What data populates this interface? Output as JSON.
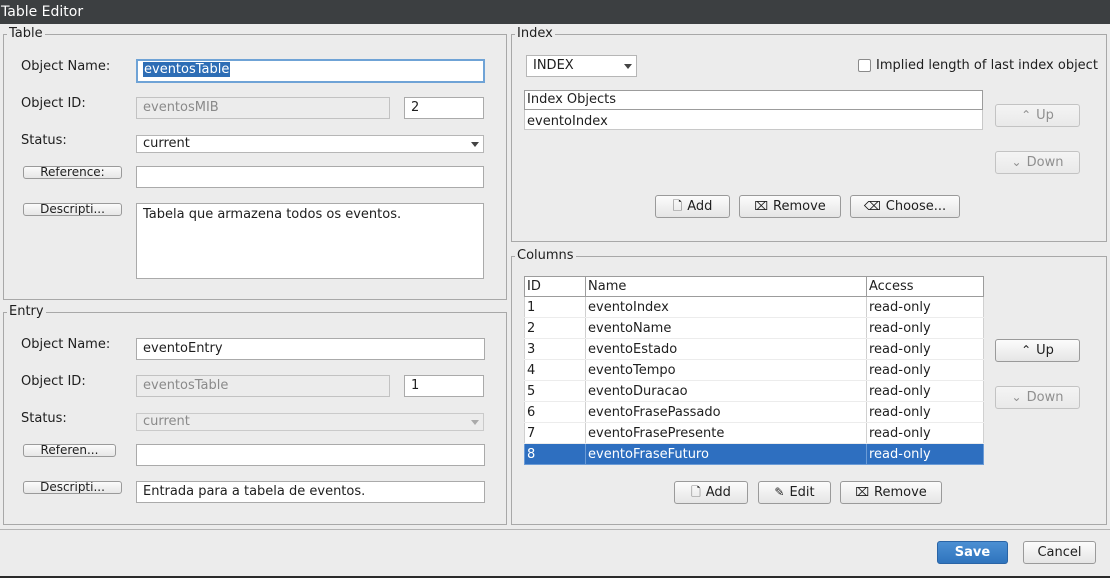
{
  "window": {
    "title": "Table Editor"
  },
  "table_group": {
    "legend": "Table",
    "object_name_label": "Object Name:",
    "object_name_value": "eventosTable",
    "object_id_label": "Object ID:",
    "object_id_parent": "eventosMIB",
    "object_id_number": "2",
    "status_label": "Status:",
    "status_value": "current",
    "reference_button": "Reference:",
    "reference_value": "",
    "description_button": "Descripti...",
    "description_value": "Tabela que armazena todos os eventos."
  },
  "entry_group": {
    "legend": "Entry",
    "object_name_label": "Object Name:",
    "object_name_value": "eventoEntry",
    "object_id_label": "Object ID:",
    "object_id_parent": "eventosTable",
    "object_id_number": "1",
    "status_label": "Status:",
    "status_value": "current",
    "reference_button": "Referen...",
    "reference_value": "",
    "description_button": "Descripti...",
    "description_value": "Entrada para a tabela de eventos."
  },
  "index_group": {
    "legend": "Index",
    "type_value": "INDEX",
    "implied_label": "Implied length of last index object",
    "implied_checked": false,
    "list_header": "Index Objects",
    "items": [
      "eventoIndex"
    ],
    "up_label": "Up",
    "down_label": "Down",
    "add_label": "Add",
    "remove_label": "Remove",
    "choose_label": "Choose..."
  },
  "columns_group": {
    "legend": "Columns",
    "headers": [
      "ID",
      "Name",
      "Access"
    ],
    "rows": [
      [
        "1",
        "eventoIndex",
        "read-only"
      ],
      [
        "2",
        "eventoName",
        "read-only"
      ],
      [
        "3",
        "eventoEstado",
        "read-only"
      ],
      [
        "4",
        "eventoTempo",
        "read-only"
      ],
      [
        "5",
        "eventoDuracao",
        "read-only"
      ],
      [
        "6",
        "eventoFrasePassado",
        "read-only"
      ],
      [
        "7",
        "eventoFrasePresente",
        "read-only"
      ],
      [
        "8",
        "eventoFraseFuturo",
        "read-only"
      ]
    ],
    "selected_row": 8,
    "up_label": "Up",
    "down_label": "Down",
    "add_label": "Add",
    "edit_label": "Edit",
    "remove_label": "Remove"
  },
  "footer": {
    "save_label": "Save",
    "cancel_label": "Cancel"
  },
  "colors": {
    "accent": "#2e6fc0",
    "titlebar": "#3c3f41",
    "dialog_bg": "#ececec"
  }
}
